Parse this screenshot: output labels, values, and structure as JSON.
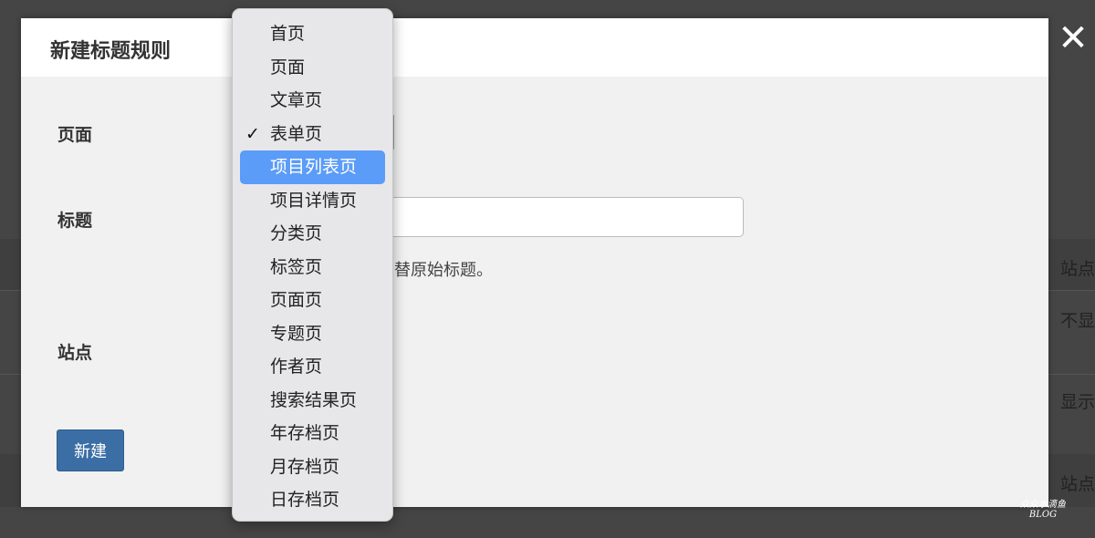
{
  "modal": {
    "title": "新建标题规则",
    "fields": {
      "page_label": "页面",
      "title_label": "标题",
      "site_label": "站点"
    },
    "title_value": "",
    "help_text": "替原始标题。",
    "create_label": "新建",
    "close_glyph": "✕"
  },
  "dropdown": {
    "selected": "表单页",
    "highlighted": "项目列表页",
    "check_glyph": "✓",
    "options": [
      "首页",
      "页面",
      "文章页",
      "表单页",
      "项目列表页",
      "项目详情页",
      "分类页",
      "标签页",
      "页面页",
      "专题页",
      "作者页",
      "搜索结果页",
      "年存档页",
      "月存档页",
      "日存档页"
    ]
  },
  "background": {
    "cells": [
      "站点",
      "不显",
      "显示",
      "站点"
    ]
  },
  "watermark": {
    "line1": "众众水滴鱼",
    "line2": "BLOG"
  },
  "colors": {
    "highlight": "#5b9cf8",
    "button": "#3a6ea5",
    "overlay": "#454545"
  }
}
